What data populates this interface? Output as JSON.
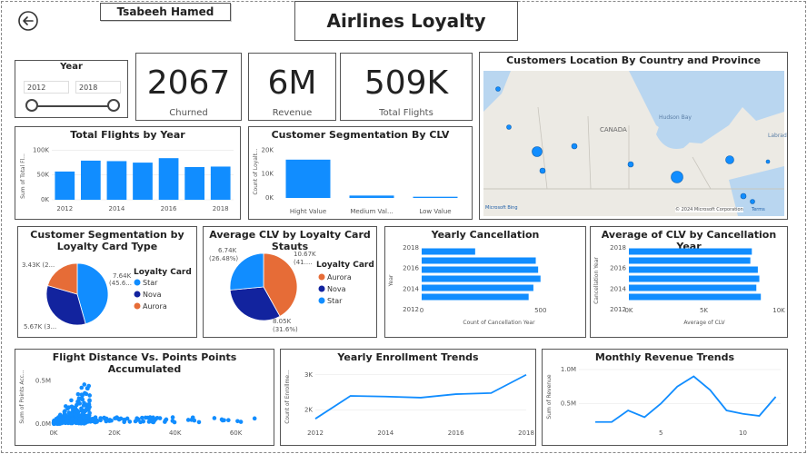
{
  "header": {
    "user_name": "Tsabeeh Hamed",
    "title": "Airlines Loyalty",
    "back_icon": "back-arrow-icon"
  },
  "slicer": {
    "title": "Year",
    "from": "2012",
    "to": "2018"
  },
  "kpis": [
    {
      "value": "2067",
      "label": "Churned"
    },
    {
      "value": "6M",
      "label": "Revenue"
    },
    {
      "value": "509K",
      "label": "Total Flights"
    }
  ],
  "map": {
    "title": "Customers Location By Country and Province",
    "labels": {
      "bay": "Hudson Bay",
      "country": "CANADA",
      "lab": "Labrad"
    },
    "brand": "Microsoft Bing",
    "copyright": "© 2024 Microsoft Corporation",
    "terms": "Terms"
  },
  "chart_data": [
    {
      "id": "flights_by_year",
      "type": "bar",
      "title": "Total Flights by Year",
      "ylabel": "Sum of Total Fl...",
      "yticks": [
        "0K",
        "50K",
        "100K"
      ],
      "xticks": [
        "2012",
        "2014",
        "2016",
        "2018"
      ],
      "categories": [
        "2012",
        "2013",
        "2014",
        "2015",
        "2016",
        "2017",
        "2018"
      ],
      "values": [
        57000,
        79000,
        78000,
        75000,
        84000,
        66000,
        67000
      ],
      "ylim": [
        0,
        110000
      ],
      "color": "#118DFF"
    },
    {
      "id": "seg_clv",
      "type": "bar",
      "title": "Customer Segmentation By CLV",
      "ylabel": "Count of Loyalt...",
      "yticks": [
        "0K",
        "10K",
        "20K"
      ],
      "categories": [
        "Hight Value",
        "Medium Val...",
        "Low Value"
      ],
      "values": [
        16000,
        1000,
        500
      ],
      "ylim": [
        0,
        22000
      ],
      "color": "#118DFF"
    },
    {
      "id": "seg_loyalty_card",
      "type": "pie",
      "title": "Customer Segmentation by Loyalty Card Type",
      "legend_title": "Loyalty Card",
      "slices": [
        {
          "name": "Star",
          "value": 7640,
          "color": "#118DFF"
        },
        {
          "name": "Nova",
          "value": 5670,
          "color": "#12239E"
        },
        {
          "name": "Aurora",
          "value": 3430,
          "color": "#E66C37"
        }
      ],
      "data_labels": [
        "7.64K",
        "(45.6...",
        "5.67K (3...",
        "3.43K (2..."
      ]
    },
    {
      "id": "avg_clv_card",
      "type": "pie",
      "title": "Average CLV by Loyalty Card Stauts",
      "legend_title": "Loyalty Card",
      "slices": [
        {
          "name": "Aurora",
          "value": 10670,
          "color": "#E66C37"
        },
        {
          "name": "Nova",
          "value": 8050,
          "color": "#12239E"
        },
        {
          "name": "Star",
          "value": 6740,
          "color": "#118DFF"
        }
      ],
      "data_labels": [
        "10.67K",
        "(41....",
        "8.05K",
        "(31.6%)",
        "6.74K",
        "(26.48%)"
      ]
    },
    {
      "id": "yearly_cancellation",
      "type": "bar",
      "orientation": "horizontal",
      "title": "Yearly Cancellation",
      "ylabel": "Year",
      "xlabel": "Count of Cancellation Year",
      "yticks": [
        "2018",
        "2016",
        "2014",
        "2012"
      ],
      "xticks": [
        "0",
        "500"
      ],
      "categories": [
        "2018",
        "2017",
        "2016",
        "2015",
        "2014",
        "2013"
      ],
      "values": [
        225,
        480,
        490,
        500,
        470,
        450
      ],
      "xlim": [
        0,
        650
      ],
      "color": "#118DFF"
    },
    {
      "id": "avg_clv_cancellation",
      "type": "bar",
      "orientation": "horizontal",
      "title": "Average of CLV by Cancellation Year",
      "ylabel": "Cancellation Year",
      "xlabel": "Average of CLV",
      "yticks": [
        "2018",
        "2016",
        "2014",
        "2012"
      ],
      "xticks": [
        "0K",
        "5K",
        "10K"
      ],
      "categories": [
        "2018",
        "2017",
        "2016",
        "2015",
        "2014",
        "2013"
      ],
      "values": [
        8200,
        8100,
        8600,
        8700,
        8500,
        8800
      ],
      "xlim": [
        0,
        10000
      ],
      "color": "#118DFF"
    },
    {
      "id": "distance_points",
      "type": "scatter",
      "title": "Flight Distance Vs. Points Points Accumulated",
      "ylabel": "Sum of Points Acc...",
      "yticks": [
        "0.0M",
        "0.5M"
      ],
      "xticks": [
        "0K",
        "20K",
        "40K",
        "60K"
      ],
      "xlim": [
        0,
        70000
      ],
      "ylim": [
        0,
        650000
      ],
      "color": "#118DFF"
    },
    {
      "id": "yearly_enrollment",
      "type": "line",
      "title": "Yearly Enrollment Trends",
      "ylabel": "Count of Enrollme...",
      "yticks": [
        "2K",
        "3K"
      ],
      "xticks": [
        "2012",
        "2014",
        "2016",
        "2018"
      ],
      "x": [
        2012,
        2013,
        2014,
        2015,
        2016,
        2017,
        2018
      ],
      "values": [
        1750,
        2400,
        2380,
        2350,
        2450,
        2480,
        3000
      ],
      "ylim": [
        1600,
        3200
      ],
      "color": "#118DFF"
    },
    {
      "id": "monthly_revenue",
      "type": "line",
      "title": "Monthly Revenue Trends",
      "ylabel": "Sum of Revenue",
      "yticks": [
        "0.5M",
        "1.0M"
      ],
      "xticks": [
        "5",
        "10"
      ],
      "x": [
        1,
        2,
        3,
        4,
        5,
        6,
        7,
        8,
        9,
        10,
        11,
        12
      ],
      "values": [
        230000,
        230000,
        400000,
        300000,
        500000,
        750000,
        900000,
        700000,
        400000,
        350000,
        320000,
        600000
      ],
      "ylim": [
        200000,
        1000000
      ],
      "color": "#118DFF"
    }
  ]
}
